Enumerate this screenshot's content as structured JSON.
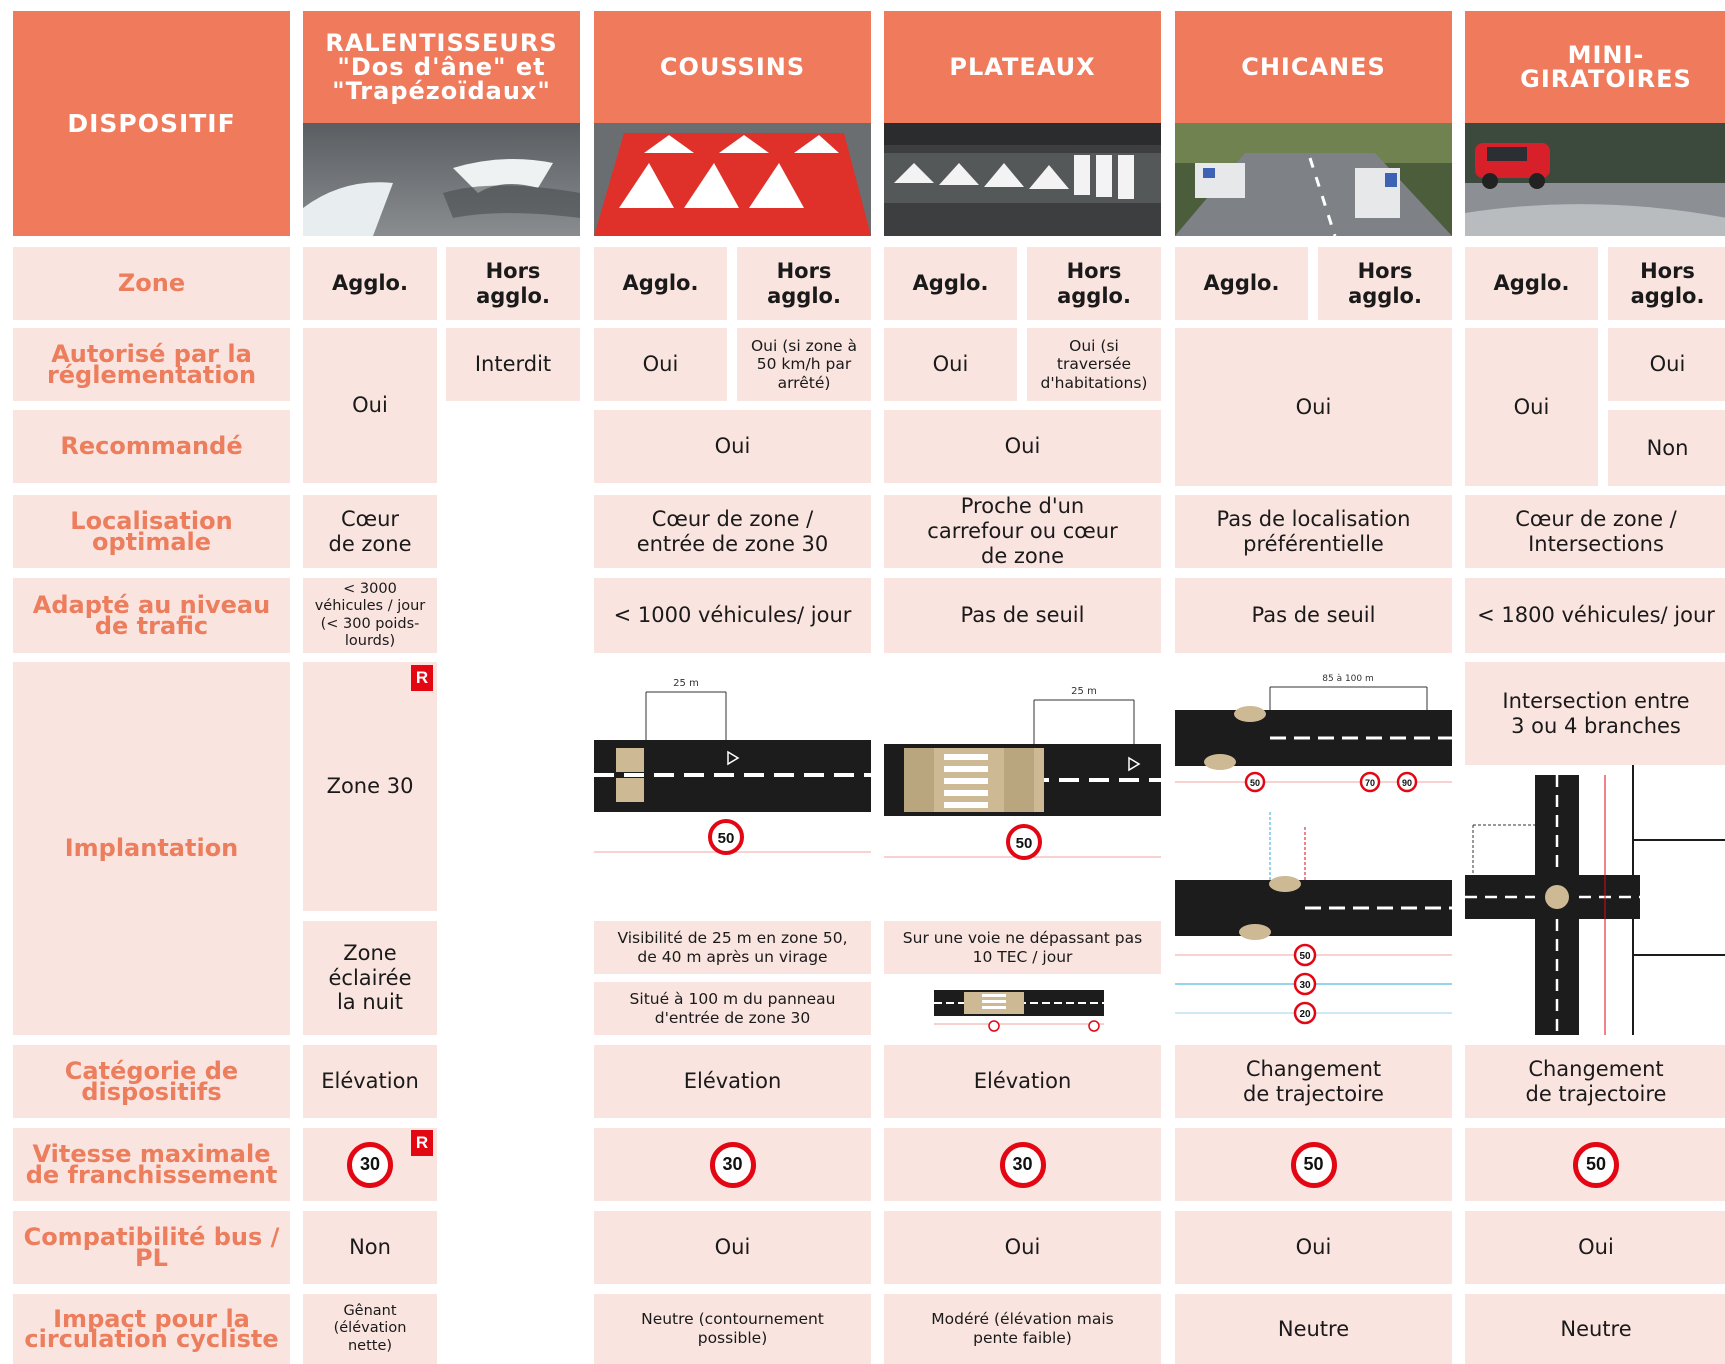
{
  "header": {
    "dispositif": "DISPOSITIF",
    "columns": [
      {
        "title": "RALENTISSEURS \"Dos d'âne\" et \"Trapézoïdaux\""
      },
      {
        "title": "COUSSINS"
      },
      {
        "title": "PLATEAUX"
      },
      {
        "title": "CHICANES"
      },
      {
        "title": "MINI-GIRATOIRES"
      }
    ]
  },
  "rows": {
    "zone": "Zone",
    "autorise": "Autorisé par la réglementation",
    "recommande": "Recommandé",
    "localisation": "Localisation optimale",
    "trafic": "Adapté au niveau de trafic",
    "implantation": "Implantation",
    "categorie": "Catégorie de dispositifs",
    "vitesse": "Vitesse maximale de franchissement",
    "bus": "Compatibilité bus / PL",
    "cyclo": "Impact pour la circulation cycliste"
  },
  "zone_labels": {
    "agglo": "Agglo.",
    "hors": "Hors agglo."
  },
  "ralentisseurs": {
    "autorise_agglo": "Oui",
    "autorise_hors": "Interdit",
    "localisation": "Cœur de zone",
    "trafic": "< 3000 véhicules / jour (< 300 poids-lourds)",
    "implantation_1": "Zone 30",
    "implantation_2": "Zone éclairée la nuit",
    "badge": "R",
    "categorie": "Elévation",
    "vitesse": "30",
    "bus": "Non",
    "cyclo": "Gênant (élévation nette)"
  },
  "coussins": {
    "autorise_agglo": "Oui",
    "autorise_hors": "Oui (si zone à 50 km/h par arrêté)",
    "recommande": "Oui",
    "localisation": "Cœur de zone / entrée de zone 30",
    "trafic": "< 1000 véhicules/ jour",
    "note_1": "Visibilité de 25 m en zone 50, de 40 m après un virage",
    "note_2": "Situé à 100 m du panneau d'entrée de zone 30",
    "diagram_distance": "25 m",
    "diagram_sign": "50",
    "categorie": "Elévation",
    "vitesse": "30",
    "bus": "Oui",
    "cyclo": "Neutre (contournement possible)"
  },
  "plateaux": {
    "autorise_agglo": "Oui",
    "autorise_hors": "Oui (si traversée d'habitations)",
    "recommande": "Oui",
    "localisation": "Proche d'un carrefour ou cœur de zone",
    "trafic": "Pas de seuil",
    "note_1": "Sur une voie ne dépassant pas 10 TEC / jour",
    "diagram_distance": "25 m",
    "diagram_sign": "50",
    "categorie": "Elévation",
    "vitesse": "30",
    "bus": "Oui",
    "cyclo": "Modéré (élévation mais pente faible)"
  },
  "chicanes": {
    "autorise": "Oui",
    "localisation": "Pas de localisation préférentielle",
    "trafic": "Pas de seuil",
    "diagram_distance": "85 à 100 m",
    "diagram_signs": [
      "50",
      "70",
      "90",
      "50",
      "30",
      "20"
    ],
    "categorie": "Changement de trajectoire",
    "vitesse": "50",
    "bus": "Oui",
    "cyclo": "Neutre"
  },
  "giratoires": {
    "autorise_agglo": "Oui",
    "autorise_hors": "Oui",
    "recommande_hors": "Non",
    "localisation": "Cœur de zone / Intersections",
    "trafic": "< 1800 véhicules/ jour",
    "implantation": "Intersection entre 3 ou 4 branches",
    "categorie": "Changement de trajectoire",
    "vitesse": "50",
    "bus": "Oui",
    "cyclo": "Neutre"
  },
  "colors": {
    "header": "#ef7a5c",
    "cell": "#f9e4df",
    "label": "#ec7d5d",
    "badge": "#e30613"
  }
}
